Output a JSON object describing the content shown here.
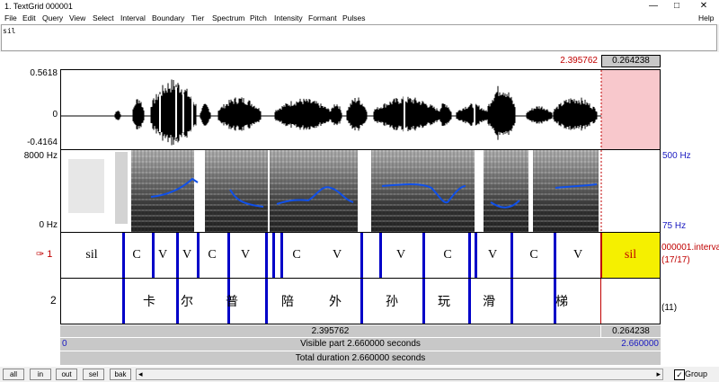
{
  "window": {
    "title": "1. TextGrid 000001",
    "minimize": "—",
    "maximize": "□",
    "close": "✕"
  },
  "menu": {
    "items": [
      "File",
      "Edit",
      "Query",
      "View",
      "Select",
      "Interval",
      "Boundary",
      "Tier",
      "Spectrum",
      "Pitch",
      "Intensity",
      "Formant",
      "Pulses"
    ],
    "help": "Help"
  },
  "text_field": {
    "value": "sil"
  },
  "selection": {
    "start_time": "2.395762",
    "duration": "0.264238"
  },
  "waveform": {
    "max": "0.5618",
    "zero": "0",
    "min": "-0.4164"
  },
  "spectrogram": {
    "top_freq": "8000 Hz",
    "bottom_freq": "0 Hz",
    "pitch_top": "500 Hz",
    "pitch_bottom": "75 Hz"
  },
  "tiers": [
    {
      "number": "1",
      "arrow": "✑",
      "intervals": [
        "sil",
        "C",
        "V",
        "V",
        "C",
        "V",
        "C",
        "V",
        "V",
        "C",
        "V",
        "C",
        "V"
      ],
      "selected_label": "sil",
      "info_name": "000001.interva",
      "info_count": "(17/17)"
    },
    {
      "number": "2",
      "intervals": [
        "卡",
        "尔",
        "普",
        "陪",
        "外",
        "孙",
        "玩",
        "滑",
        "梯"
      ],
      "info_count": "(11)"
    }
  ],
  "bottom_bars": {
    "time_left": "2.395762",
    "time_right": "0.264238",
    "visible_start": "0",
    "visible_text": "Visible part 2.660000 seconds",
    "visible_end": "2.660000",
    "total_text": "Total duration 2.660000 seconds"
  },
  "buttons": {
    "all": "all",
    "in": "in",
    "out": "out",
    "sel": "sel",
    "bak": "bak"
  },
  "group": {
    "label": "Group",
    "checked": "✓"
  },
  "colors": {
    "selection_pink": "#f8c8cc",
    "selected_interval": "#f5f000",
    "boundary": "#0000c8",
    "pitch": "#1050e8",
    "red_text": "#c00000"
  }
}
